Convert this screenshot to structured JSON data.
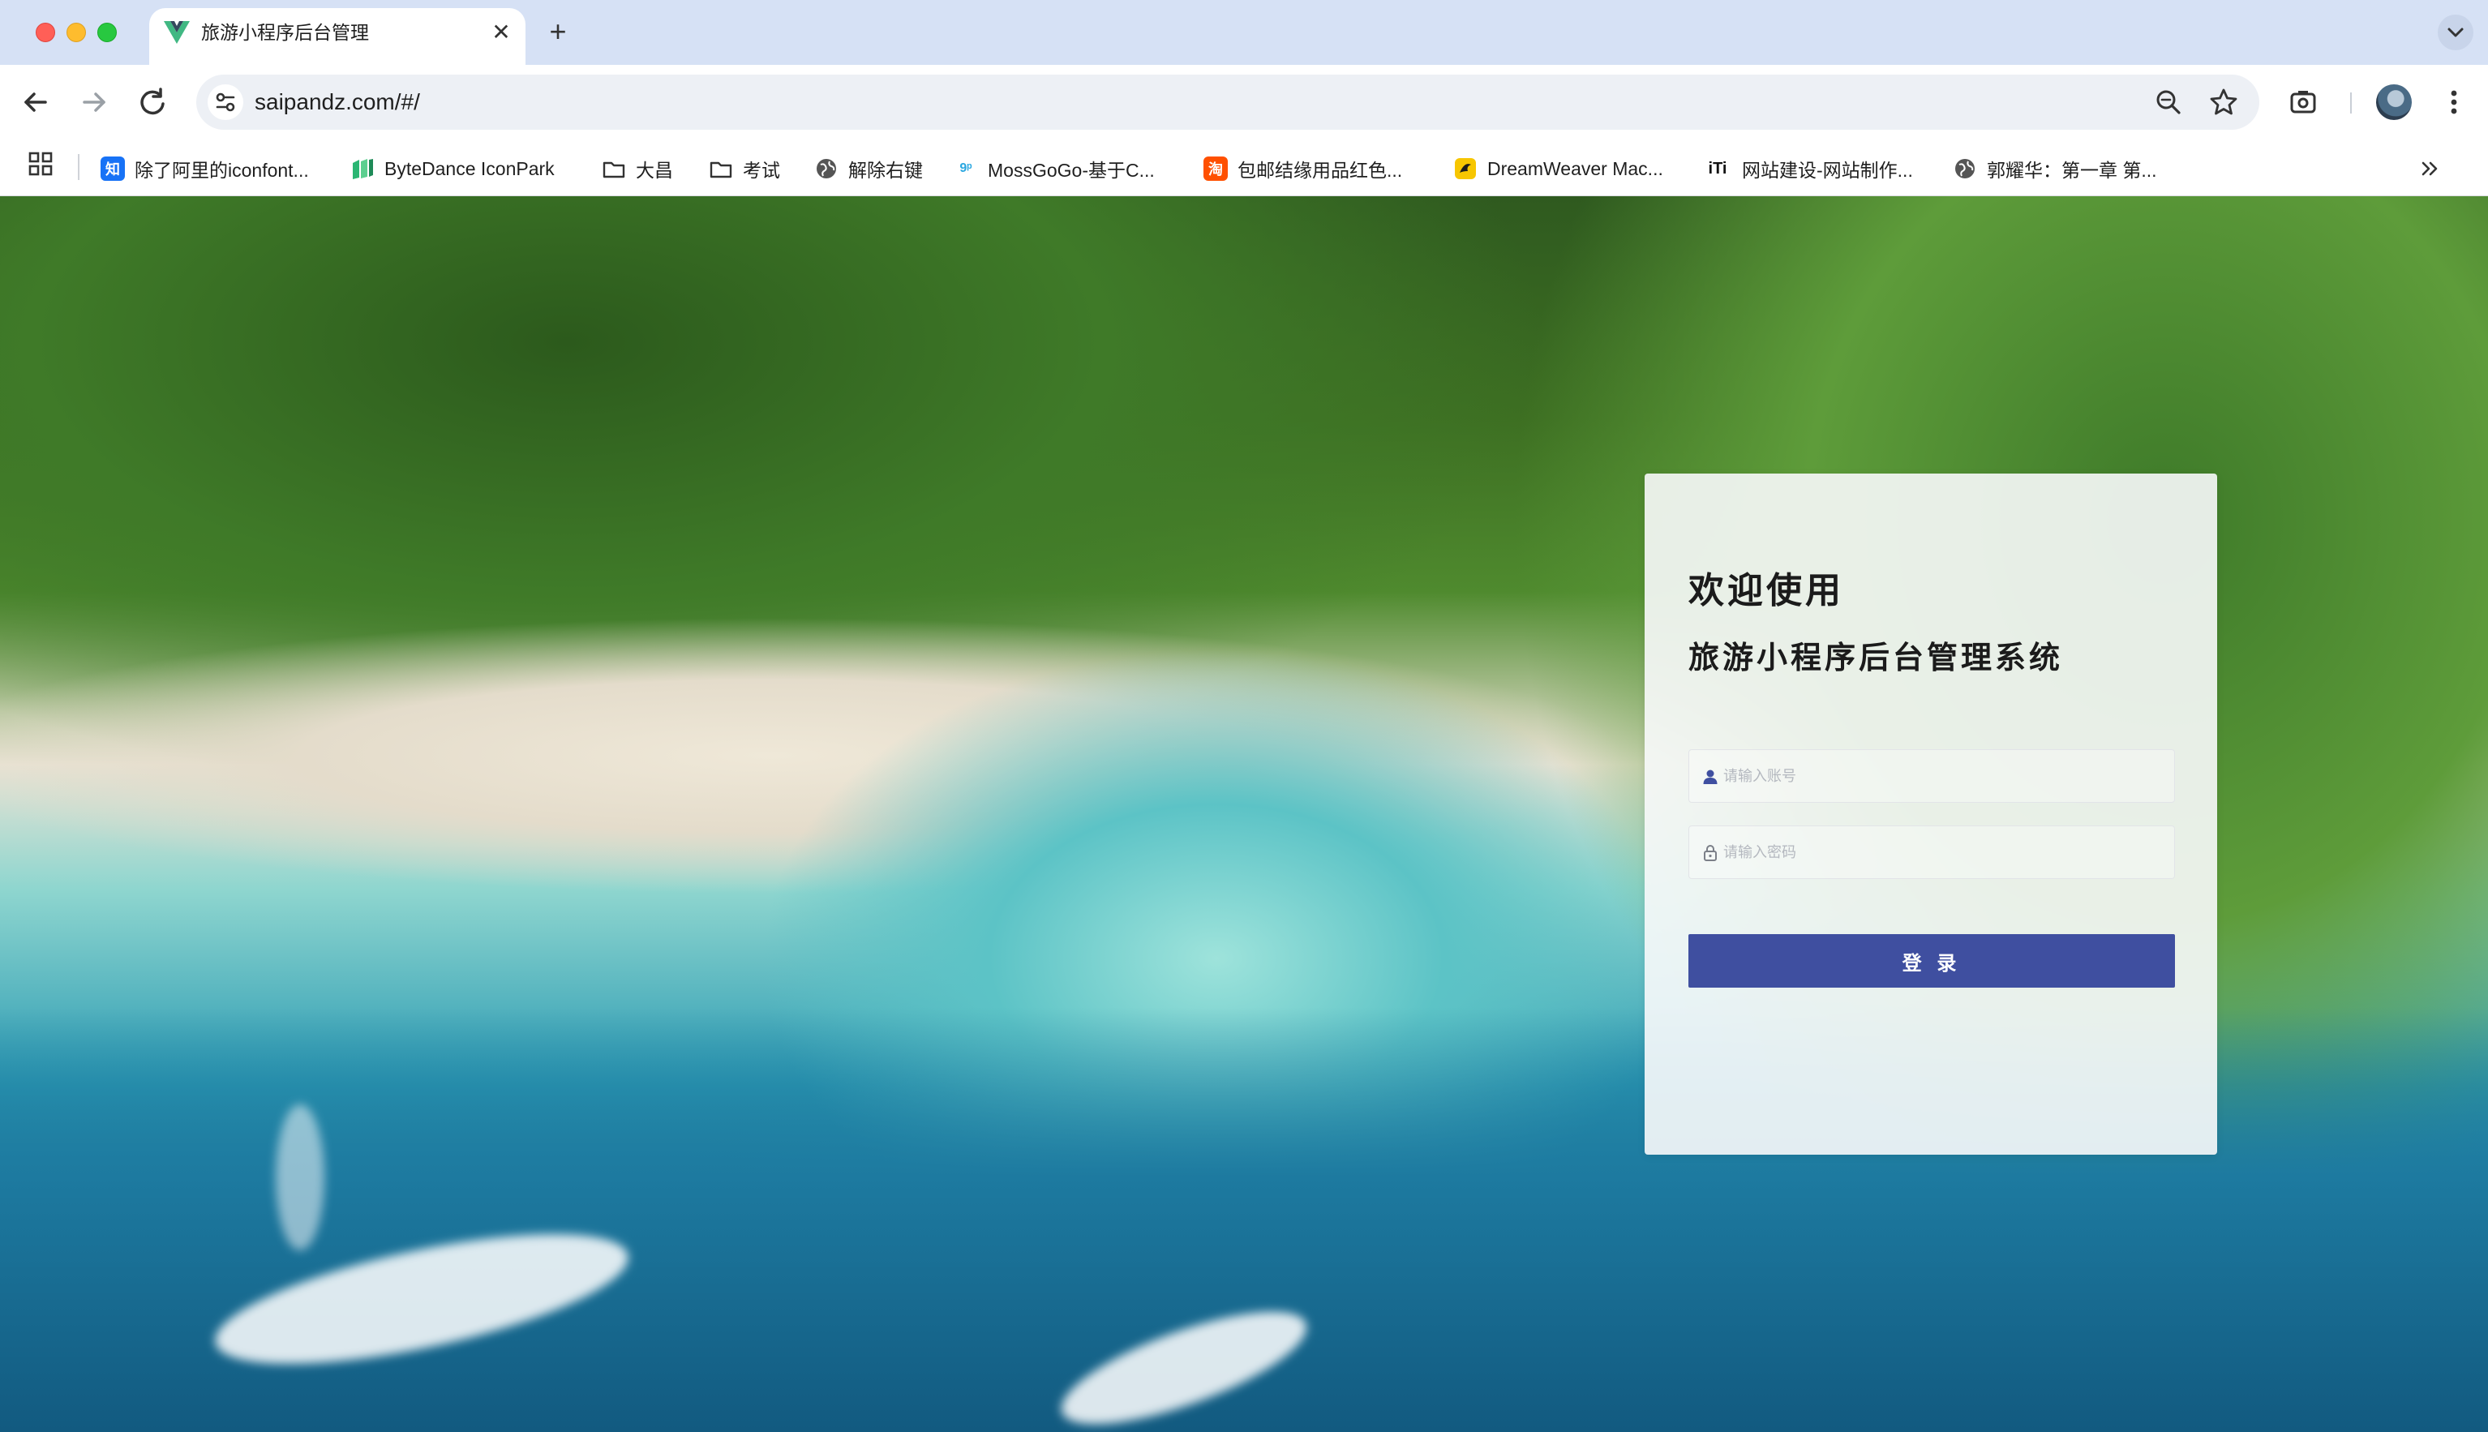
{
  "browser": {
    "tab": {
      "title": "旅游小程序后台管理",
      "favicon": "vue-logo-icon"
    },
    "address_bar": {
      "url": "saipandz.com/#/"
    },
    "bookmarks": [
      {
        "label": "除了阿里的iconfont...",
        "icon": "zhihu-icon",
        "color": "#1772f6",
        "glyph": "知"
      },
      {
        "label": "ByteDance IconPark",
        "icon": "iconpark-icon",
        "color": "#2bb673"
      },
      {
        "label": "大昌",
        "icon": "folder-icon"
      },
      {
        "label": "考试",
        "icon": "folder-icon"
      },
      {
        "label": "解除右键",
        "icon": "globe-icon"
      },
      {
        "label": "MossGoGo-基于C...",
        "icon": "mossgogo-icon",
        "color": "#2aa7e0"
      },
      {
        "label": "包邮结缘用品红色...",
        "icon": "taobao-icon",
        "color": "#ff5000",
        "glyph": "淘"
      },
      {
        "label": "DreamWeaver Mac...",
        "icon": "dreamweaver-icon",
        "color": "#f7c600"
      },
      {
        "label": "网站建设-网站制作...",
        "icon": "iti-icon",
        "glyph": "iTi"
      },
      {
        "label": "郭耀华：第一章 第...",
        "icon": "globe-icon"
      }
    ]
  },
  "login": {
    "welcome": "欢迎使用",
    "system_title": "旅游小程序后台管理系统",
    "username": {
      "placeholder": "请输入账号",
      "value": ""
    },
    "password": {
      "placeholder": "请输入密码",
      "value": ""
    },
    "submit_label": "登 录"
  },
  "colors": {
    "accent": "#3f4fa0",
    "tab_strip": "#d6e1f5"
  }
}
